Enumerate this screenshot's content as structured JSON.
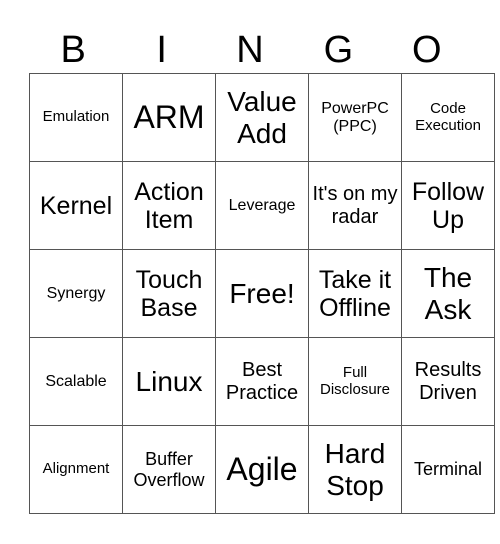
{
  "title_letters": [
    "B",
    "I",
    "N",
    "G",
    "O"
  ],
  "board": {
    "rows": [
      [
        "Emulation",
        "ARM",
        "Value Add",
        "PowerPC (PPC)",
        "Code Execution"
      ],
      [
        "Kernel",
        "Action Item",
        "Leverage",
        "It's on my radar",
        "Follow Up"
      ],
      [
        "Synergy",
        "Touch Base",
        "Free!",
        "Take it Offline",
        "The Ask"
      ],
      [
        "Scalable",
        "Linux",
        "Best Practice",
        "Full Disclosure",
        "Results Driven"
      ],
      [
        "Alignment",
        "Buffer Overflow",
        "Agile",
        "Hard Stop",
        "Terminal"
      ]
    ],
    "free_space": "Free!"
  }
}
